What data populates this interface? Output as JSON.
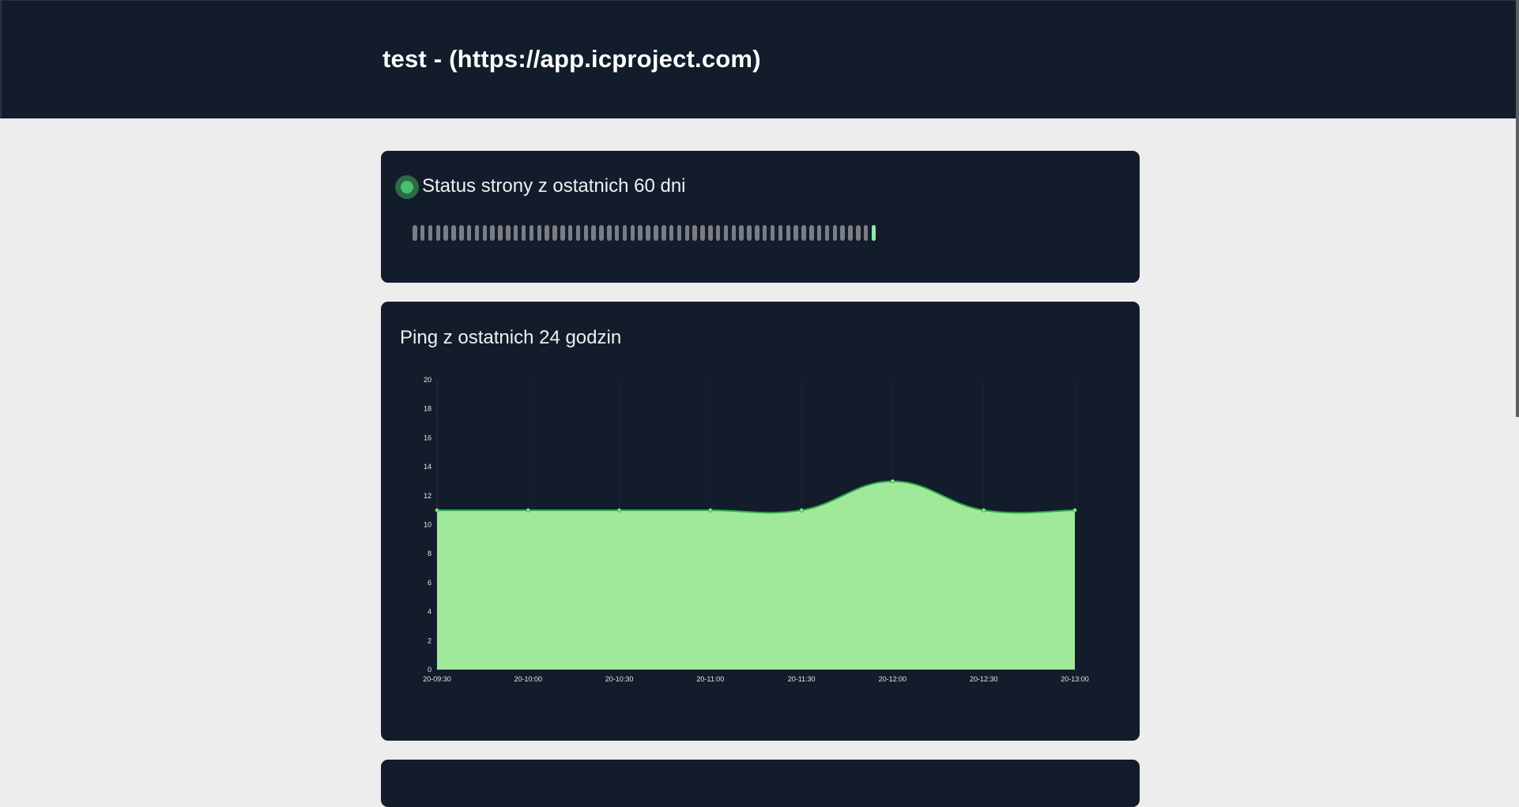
{
  "header": {
    "title": "test - (https://app.icproject.com)"
  },
  "status_card": {
    "title": "Status strony z ostatnich 60 dni",
    "status_color": "#46c06d",
    "days": [
      "unknown",
      "unknown",
      "unknown",
      "unknown",
      "unknown",
      "unknown",
      "unknown",
      "unknown",
      "unknown",
      "unknown",
      "unknown",
      "unknown",
      "unknown",
      "unknown",
      "unknown",
      "unknown",
      "unknown",
      "unknown",
      "unknown",
      "unknown",
      "unknown",
      "unknown",
      "unknown",
      "unknown",
      "unknown",
      "unknown",
      "unknown",
      "unknown",
      "unknown",
      "unknown",
      "unknown",
      "unknown",
      "unknown",
      "unknown",
      "unknown",
      "unknown",
      "unknown",
      "unknown",
      "unknown",
      "unknown",
      "unknown",
      "unknown",
      "unknown",
      "unknown",
      "unknown",
      "unknown",
      "unknown",
      "unknown",
      "unknown",
      "unknown",
      "unknown",
      "unknown",
      "unknown",
      "unknown",
      "unknown",
      "unknown",
      "unknown",
      "unknown",
      "unknown",
      "up"
    ]
  },
  "ping_card": {
    "title": "Ping z ostatnich 24 godzin"
  },
  "chart_data": {
    "type": "area",
    "title": "",
    "xlabel": "",
    "ylabel": "",
    "x": [
      "20-09:30",
      "20-10:00",
      "20-10:30",
      "20-11:00",
      "20-11:30",
      "20-12:00",
      "20-12:30",
      "20-13:00"
    ],
    "y_ticks": [
      0,
      2,
      4,
      6,
      8,
      10,
      12,
      14,
      16,
      18,
      20
    ],
    "ylim": [
      0,
      20
    ],
    "grid": true,
    "series": [
      {
        "values": [
          11,
          11,
          11,
          11,
          11,
          13,
          11,
          11
        ],
        "fill": "#a0e99b",
        "line": "#2ea84a"
      }
    ]
  }
}
